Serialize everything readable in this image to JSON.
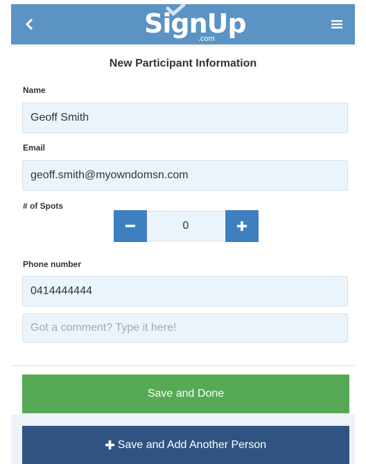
{
  "header": {
    "logo_text": "SignUp",
    "logo_sub": ".com",
    "back_icon": "chevron-left-icon",
    "menu_icon": "hamburger-menu-icon",
    "background_color": "#5b93c4"
  },
  "form": {
    "title": "New Participant Information",
    "name": {
      "label": "Name",
      "value": "Geoff Smith"
    },
    "email": {
      "label": "Email",
      "value": "geoff.smith@myowndomsn.com"
    },
    "spots": {
      "label": "# of Spots",
      "value": "0",
      "minus_icon": "minus-icon",
      "plus_icon": "plus-icon"
    },
    "phone": {
      "label": "Phone number",
      "value": "0414444444"
    },
    "comment": {
      "placeholder": "Got a comment? Type it here!"
    }
  },
  "actions": {
    "save_done_label": "Save and Done",
    "save_add_label": "Save and Add Another Person",
    "save_done_color": "#56aa56",
    "save_add_color": "#305481"
  }
}
